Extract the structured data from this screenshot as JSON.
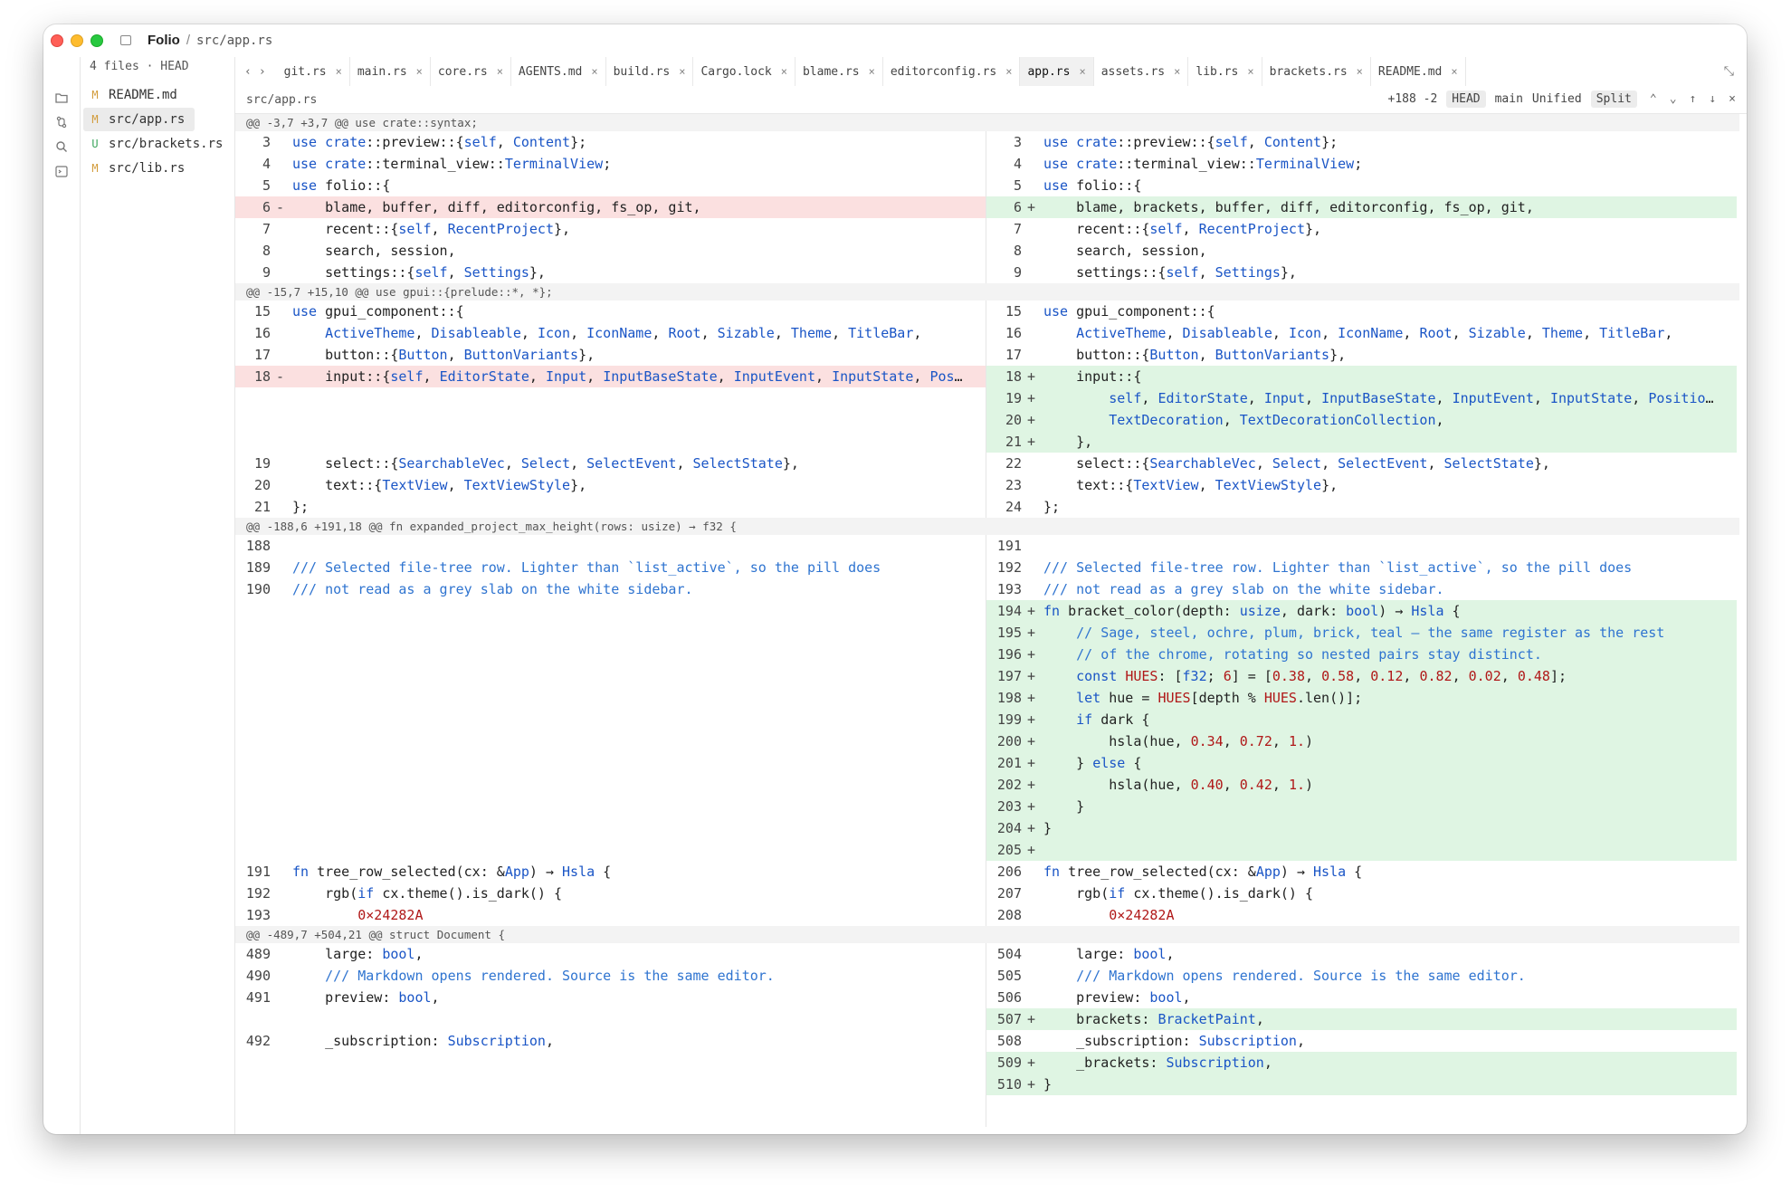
{
  "window": {
    "project": "Folio",
    "separator": "/",
    "path": "src/app.rs"
  },
  "files_panel": {
    "header": "4 files · HEAD",
    "items": [
      {
        "status": "M",
        "name": "README.md"
      },
      {
        "status": "M",
        "name": "src/app.rs",
        "active": true
      },
      {
        "status": "U",
        "name": "src/brackets.rs"
      },
      {
        "status": "M",
        "name": "src/lib.rs"
      }
    ]
  },
  "tabs": [
    {
      "label": "git.rs"
    },
    {
      "label": "main.rs"
    },
    {
      "label": "core.rs"
    },
    {
      "label": "AGENTS.md"
    },
    {
      "label": "build.rs"
    },
    {
      "label": "Cargo.lock"
    },
    {
      "label": "blame.rs"
    },
    {
      "label": "editorconfig.rs"
    },
    {
      "label": "app.rs",
      "active": true
    },
    {
      "label": "assets.rs"
    },
    {
      "label": "lib.rs"
    },
    {
      "label": "brackets.rs"
    },
    {
      "label": "README.md"
    }
  ],
  "icons": {
    "nav_back": "‹",
    "nav_fwd": "›",
    "close": "×",
    "collapse": "⤡",
    "folder": "folder-icon",
    "branch": "git-branch-icon",
    "search": "search-icon",
    "terminal": "terminal-icon",
    "settings": "gear-icon"
  },
  "diff_header": {
    "path": "src/app.rs",
    "stats": "+188 -2",
    "base": "HEAD",
    "target": "main",
    "mode_unified": "Unified",
    "mode_split": "Split",
    "arrows": [
      "⌃",
      "⌄",
      "↑",
      "↓"
    ],
    "close": "×"
  },
  "hunks": [
    "@@ -3,7 +3,7 @@ use crate::syntax;",
    "@@ -15,7 +15,10 @@ use gpui::{prelude::*, *};",
    "@@ -188,6 +191,18 @@ fn expanded_project_max_height(rows: usize) → f32 {",
    "@@ -489,7 +504,21 @@ struct Document {"
  ],
  "left_lines": [
    {
      "ln": "3",
      "text": "use crate::preview::{self, Content};"
    },
    {
      "ln": "4",
      "text": "use crate::terminal_view::TerminalView;"
    },
    {
      "ln": "5",
      "text": "use folio::{"
    },
    {
      "ln": "6",
      "mark": "-",
      "text": "    blame, buffer, diff, editorconfig, fs_op, git,"
    },
    {
      "ln": "7",
      "text": "    recent::{self, RecentProject},"
    },
    {
      "ln": "8",
      "text": "    search, session,"
    },
    {
      "ln": "9",
      "text": "    settings::{self, Settings},"
    },
    {
      "ln": "15",
      "text": "use gpui_component::{"
    },
    {
      "ln": "16",
      "text": "    ActiveTheme, Disableable, Icon, IconName, Root, Sizable, Theme, TitleBar,"
    },
    {
      "ln": "17",
      "text": "    button::{Button, ButtonVariants},"
    },
    {
      "ln": "18",
      "mark": "-",
      "text": "    input::{self, EditorState, Input, InputBaseState, InputEvent, InputState, Pos…"
    },
    {
      "ln": "19",
      "text": "    select::{SearchableVec, Select, SelectEvent, SelectState},"
    },
    {
      "ln": "20",
      "text": "    text::{TextView, TextViewStyle},"
    },
    {
      "ln": "21",
      "text": "};"
    },
    {
      "ln": "188",
      "text": ""
    },
    {
      "ln": "189",
      "text": "/// Selected file-tree row. Lighter than `list_active`, so the pill does"
    },
    {
      "ln": "190",
      "text": "/// not read as a grey slab on the white sidebar."
    },
    {
      "ln": "191",
      "text": "fn tree_row_selected(cx: &App) → Hsla {"
    },
    {
      "ln": "192",
      "text": "    rgb(if cx.theme().is_dark() {"
    },
    {
      "ln": "193",
      "text": "        0×24282A"
    },
    {
      "ln": "489",
      "text": "    large: bool,"
    },
    {
      "ln": "490",
      "text": "    /// Markdown opens rendered. Source is the same editor."
    },
    {
      "ln": "491",
      "text": "    preview: bool,"
    },
    {
      "ln": "492",
      "text": "    _subscription: Subscription,"
    }
  ],
  "right_lines": [
    {
      "ln": "3",
      "text": "use crate::preview::{self, Content};"
    },
    {
      "ln": "4",
      "text": "use crate::terminal_view::TerminalView;"
    },
    {
      "ln": "5",
      "text": "use folio::{"
    },
    {
      "ln": "6",
      "mark": "+",
      "text": "    blame, brackets, buffer, diff, editorconfig, fs_op, git,"
    },
    {
      "ln": "7",
      "text": "    recent::{self, RecentProject},"
    },
    {
      "ln": "8",
      "text": "    search, session,"
    },
    {
      "ln": "9",
      "text": "    settings::{self, Settings},"
    },
    {
      "ln": "15",
      "text": "use gpui_component::{"
    },
    {
      "ln": "16",
      "text": "    ActiveTheme, Disableable, Icon, IconName, Root, Sizable, Theme, TitleBar,"
    },
    {
      "ln": "17",
      "text": "    button::{Button, ButtonVariants},"
    },
    {
      "ln": "18",
      "mark": "+",
      "text": "    input::{"
    },
    {
      "ln": "19",
      "mark": "+",
      "text": "        self, EditorState, Input, InputBaseState, InputEvent, InputState, Positio…"
    },
    {
      "ln": "20",
      "mark": "+",
      "text": "        TextDecoration, TextDecorationCollection,"
    },
    {
      "ln": "21",
      "mark": "+",
      "text": "    },"
    },
    {
      "ln": "22",
      "text": "    select::{SearchableVec, Select, SelectEvent, SelectState},"
    },
    {
      "ln": "23",
      "text": "    text::{TextView, TextViewStyle},"
    },
    {
      "ln": "24",
      "text": "};"
    },
    {
      "ln": "191",
      "text": ""
    },
    {
      "ln": "192",
      "text": "/// Selected file-tree row. Lighter than `list_active`, so the pill does"
    },
    {
      "ln": "193",
      "text": "/// not read as a grey slab on the white sidebar."
    },
    {
      "ln": "194",
      "mark": "+",
      "text": "fn bracket_color(depth: usize, dark: bool) → Hsla {"
    },
    {
      "ln": "195",
      "mark": "+",
      "text": "    // Sage, steel, ochre, plum, brick, teal — the same register as the rest"
    },
    {
      "ln": "196",
      "mark": "+",
      "text": "    // of the chrome, rotating so nested pairs stay distinct."
    },
    {
      "ln": "197",
      "mark": "+",
      "text": "    const HUES: [f32; 6] = [0.38, 0.58, 0.12, 0.82, 0.02, 0.48];"
    },
    {
      "ln": "198",
      "mark": "+",
      "text": "    let hue = HUES[depth % HUES.len()];"
    },
    {
      "ln": "199",
      "mark": "+",
      "text": "    if dark {"
    },
    {
      "ln": "200",
      "mark": "+",
      "text": "        hsla(hue, 0.34, 0.72, 1.)"
    },
    {
      "ln": "201",
      "mark": "+",
      "text": "    } else {"
    },
    {
      "ln": "202",
      "mark": "+",
      "text": "        hsla(hue, 0.40, 0.42, 1.)"
    },
    {
      "ln": "203",
      "mark": "+",
      "text": "    }"
    },
    {
      "ln": "204",
      "mark": "+",
      "text": "}"
    },
    {
      "ln": "205",
      "mark": "+",
      "text": ""
    },
    {
      "ln": "206",
      "text": "fn tree_row_selected(cx: &App) → Hsla {"
    },
    {
      "ln": "207",
      "text": "    rgb(if cx.theme().is_dark() {"
    },
    {
      "ln": "208",
      "text": "        0×24282A"
    },
    {
      "ln": "504",
      "text": "    large: bool,"
    },
    {
      "ln": "505",
      "text": "    /// Markdown opens rendered. Source is the same editor."
    },
    {
      "ln": "506",
      "text": "    preview: bool,"
    },
    {
      "ln": "507",
      "mark": "+",
      "text": "    brackets: BracketPaint,"
    },
    {
      "ln": "508",
      "text": "    _subscription: Subscription,"
    },
    {
      "ln": "509",
      "mark": "+",
      "text": "    _brackets: Subscription,"
    },
    {
      "ln": "510",
      "mark": "+",
      "text": "}"
    }
  ],
  "colors": {
    "added_bg": "#dff5e3",
    "removed_bg": "#fbe0e0",
    "keyword": "#1a55c6",
    "comment": "#2f74d0",
    "number": "#b01818",
    "status_modified": "#d29b3a",
    "status_untracked": "#3ba55c"
  }
}
